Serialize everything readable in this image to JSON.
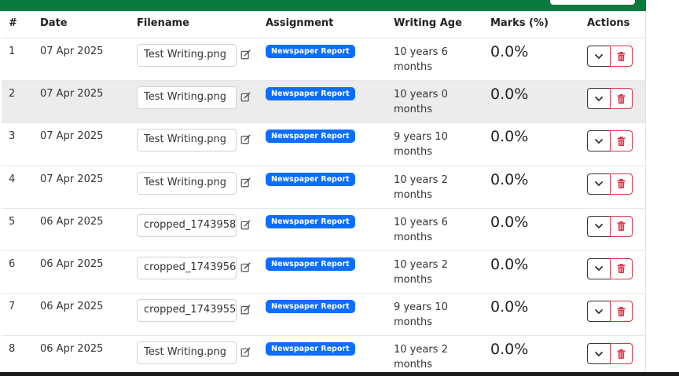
{
  "table": {
    "headers": {
      "num": "#",
      "date": "Date",
      "filename": "Filename",
      "assignment": "Assignment",
      "writing_age": "Writing Age",
      "marks": "Marks (%)",
      "actions": "Actions"
    },
    "rows": [
      {
        "num": "1",
        "date": "07 Apr 2025",
        "filename": "Test Writing.png",
        "assignment": "Newspaper Report",
        "age_line1": "10 years 6",
        "age_line2": "months",
        "marks": "0.0%"
      },
      {
        "num": "2",
        "date": "07 Apr 2025",
        "filename": "Test Writing.png",
        "assignment": "Newspaper Report",
        "age_line1": "10 years 0",
        "age_line2": "months",
        "marks": "0.0%"
      },
      {
        "num": "3",
        "date": "07 Apr 2025",
        "filename": "Test Writing.png",
        "assignment": "Newspaper Report",
        "age_line1": "9 years 10",
        "age_line2": "months",
        "marks": "0.0%"
      },
      {
        "num": "4",
        "date": "07 Apr 2025",
        "filename": "Test Writing.png",
        "assignment": "Newspaper Report",
        "age_line1": "10 years 2",
        "age_line2": "months",
        "marks": "0.0%"
      },
      {
        "num": "5",
        "date": "06 Apr 2025",
        "filename": "cropped_1743958",
        "assignment": "Newspaper Report",
        "age_line1": "10 years 6",
        "age_line2": "months",
        "marks": "0.0%"
      },
      {
        "num": "6",
        "date": "06 Apr 2025",
        "filename": "cropped_1743956",
        "assignment": "Newspaper Report",
        "age_line1": "10 years 2",
        "age_line2": "months",
        "marks": "0.0%"
      },
      {
        "num": "7",
        "date": "06 Apr 2025",
        "filename": "cropped_1743955",
        "assignment": "Newspaper Report",
        "age_line1": "9 years 10",
        "age_line2": "months",
        "marks": "0.0%"
      },
      {
        "num": "8",
        "date": "06 Apr 2025",
        "filename": "Test Writing.png",
        "assignment": "Newspaper Report",
        "age_line1": "10 years 2",
        "age_line2": "months",
        "marks": "0.0%"
      }
    ]
  },
  "colors": {
    "brand_green": "#0b7a3e",
    "badge_blue": "#0d6efd",
    "delete_red": "#dc3545",
    "row_highlight": "#ececec"
  },
  "icons": {
    "edit": "edit-icon",
    "dropdown": "chevron-down-icon",
    "delete": "trash-icon"
  }
}
